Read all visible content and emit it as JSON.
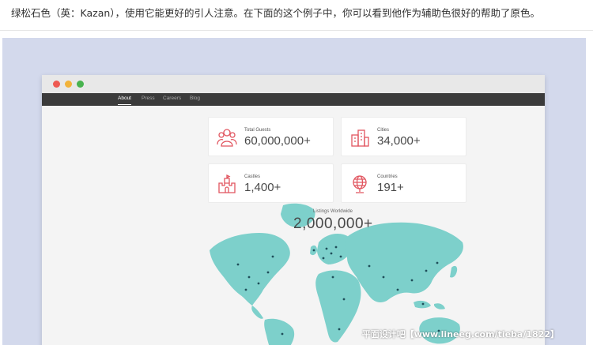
{
  "caption": "绿松石色（英：Kazan），使用它能更好的引人注意。在下面的这个例子中，你可以看到他作为辅助色很好的帮助了原色。",
  "nav": {
    "items": [
      {
        "label": "About",
        "active": true
      },
      {
        "label": "Press",
        "active": false
      },
      {
        "label": "Careers",
        "active": false
      },
      {
        "label": "Blog",
        "active": false
      }
    ]
  },
  "stats": [
    {
      "label": "Total Guests",
      "value": "60,000,000+",
      "icon": "guests-icon"
    },
    {
      "label": "Cities",
      "value": "34,000+",
      "icon": "city-icon"
    },
    {
      "label": "Castles",
      "value": "1,400+",
      "icon": "castle-icon"
    },
    {
      "label": "Countries",
      "value": "191+",
      "icon": "globe-icon"
    }
  ],
  "listings": {
    "label": "Listings Worldwide",
    "value": "2,000,000+"
  },
  "watermark": "平面设计吧【www.lineeg.com/tieba/1822】",
  "colors": {
    "accent": "#e1555f",
    "map": "#7dd0cb",
    "map_dot": "#1f4e5a",
    "stage_bg": "#d3d9ec",
    "navbar": "#3b3b3b"
  }
}
